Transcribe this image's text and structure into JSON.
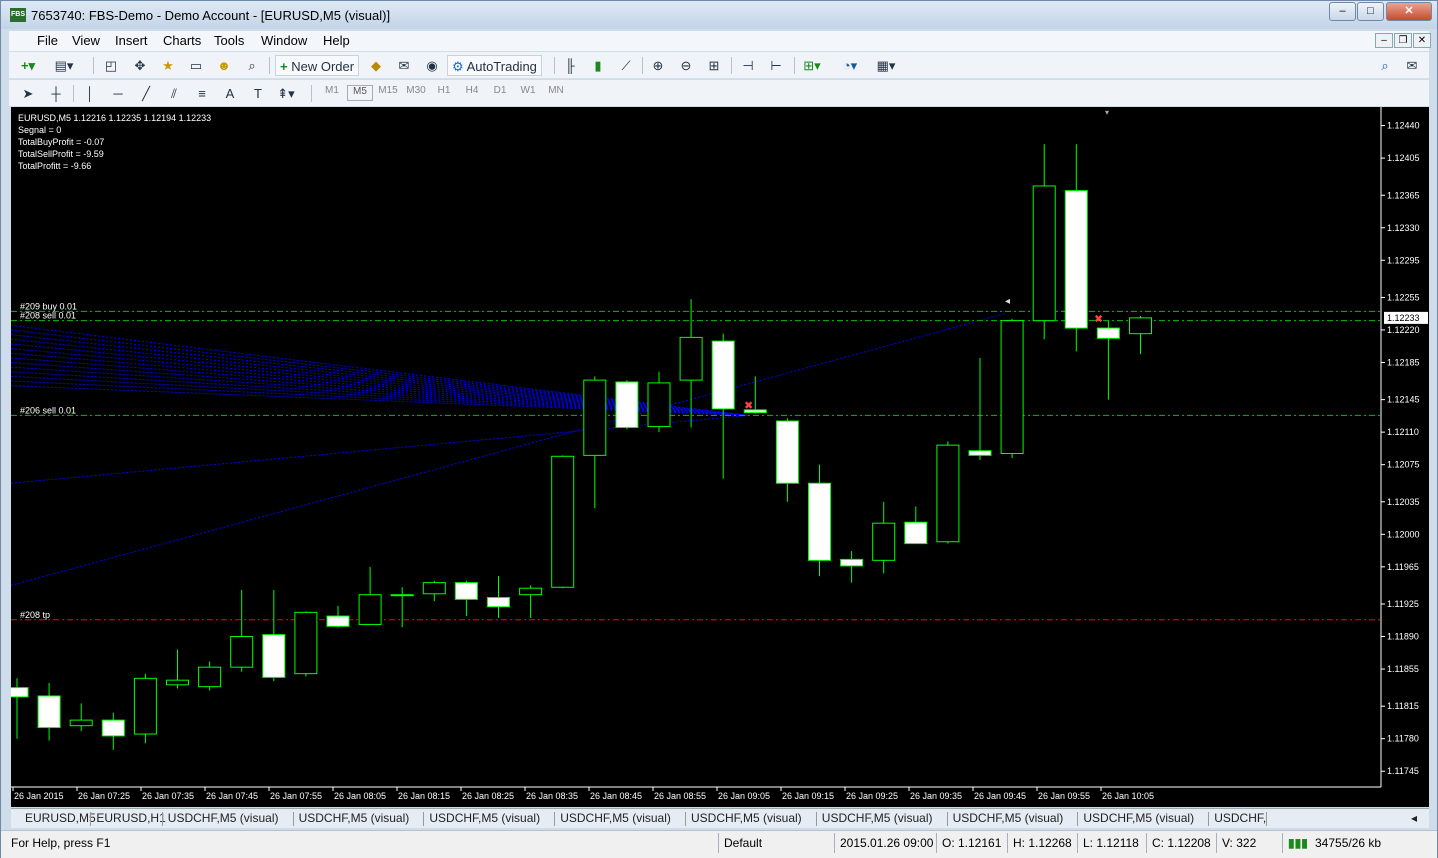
{
  "window": {
    "title": "7653740: FBS-Demo - Demo Account - [EURUSD,M5 (visual)]",
    "app_icon_text": "FBS"
  },
  "menu": [
    "File",
    "View",
    "Insert",
    "Charts",
    "Tools",
    "Window",
    "Help"
  ],
  "toolbar": {
    "new_order": "New Order",
    "auto_trading": "AutoTrading"
  },
  "timeframes": [
    "M1",
    "M5",
    "M15",
    "M30",
    "H1",
    "H4",
    "D1",
    "W1",
    "MN"
  ],
  "active_timeframe": "M5",
  "info": {
    "header": "EURUSD,M5  1.12216 1.12235 1.12194 1.12233",
    "lines": [
      "Segnal = 0",
      "TotalBuyProfit = -0.07",
      "TotalSellProfit = -9.59",
      "TotalProfitt = -9.66"
    ]
  },
  "order_labels": [
    "#209 buy 0.01",
    "#208 sell 0.01",
    "#206 sell 0.01",
    "#208 tp"
  ],
  "colors": {
    "chart_bg": "#000000",
    "candle_up_fill": "#000000",
    "candle_down_fill": "#ffffff",
    "candle_outline": "#00ff00",
    "order_line": "#00c000",
    "tp_line": "#ff0000",
    "trend_lines": "#0000ff",
    "current_price_bg": "#ffffff"
  },
  "chart_data": {
    "type": "candlestick",
    "symbol": "EURUSD",
    "timeframe": "M5",
    "ylim": [
      1.11728,
      1.1246
    ],
    "y_ticks": [
      "1.12440",
      "1.12405",
      "1.12365",
      "1.12330",
      "1.12295",
      "1.12255",
      "1.12220",
      "1.12185",
      "1.12145",
      "1.12110",
      "1.12075",
      "1.12035",
      "1.12000",
      "1.11965",
      "1.11925",
      "1.11890",
      "1.11855",
      "1.11815",
      "1.11780",
      "1.11745"
    ],
    "current_price": "1.12233",
    "x_labels": [
      "26 Jan 2015",
      "26 Jan 07:25",
      "26 Jan 07:35",
      "26 Jan 07:45",
      "26 Jan 07:55",
      "26 Jan 08:05",
      "26 Jan 08:15",
      "26 Jan 08:25",
      "26 Jan 08:35",
      "26 Jan 08:45",
      "26 Jan 08:55",
      "26 Jan 09:05",
      "26 Jan 09:15",
      "26 Jan 09:25",
      "26 Jan 09:35",
      "26 Jan 09:45",
      "26 Jan 09:55",
      "26 Jan 10:05"
    ],
    "candles": [
      {
        "o": 1.11835,
        "h": 1.11845,
        "l": 1.1178,
        "c": 1.11825
      },
      {
        "o": 1.11826,
        "h": 1.1184,
        "l": 1.11778,
        "c": 1.11792
      },
      {
        "o": 1.11794,
        "h": 1.11818,
        "l": 1.11788,
        "c": 1.118
      },
      {
        "o": 1.118,
        "h": 1.11808,
        "l": 1.11768,
        "c": 1.11783
      },
      {
        "o": 1.11785,
        "h": 1.1185,
        "l": 1.11775,
        "c": 1.11845
      },
      {
        "o": 1.11838,
        "h": 1.11876,
        "l": 1.11834,
        "c": 1.11843
      },
      {
        "o": 1.11836,
        "h": 1.11863,
        "l": 1.11832,
        "c": 1.11857
      },
      {
        "o": 1.11857,
        "h": 1.1194,
        "l": 1.11852,
        "c": 1.1189
      },
      {
        "o": 1.11892,
        "h": 1.1194,
        "l": 1.11842,
        "c": 1.11846
      },
      {
        "o": 1.1185,
        "h": 1.11917,
        "l": 1.11847,
        "c": 1.11916
      },
      {
        "o": 1.11912,
        "h": 1.11923,
        "l": 1.119,
        "c": 1.11901
      },
      {
        "o": 1.11903,
        "h": 1.11965,
        "l": 1.11903,
        "c": 1.11935
      },
      {
        "o": 1.11935,
        "h": 1.11943,
        "l": 1.119,
        "c": 1.11935
      },
      {
        "o": 1.11936,
        "h": 1.1195,
        "l": 1.11928,
        "c": 1.11948
      },
      {
        "o": 1.11948,
        "h": 1.1195,
        "l": 1.11912,
        "c": 1.1193
      },
      {
        "o": 1.11932,
        "h": 1.11955,
        "l": 1.1191,
        "c": 1.11922
      },
      {
        "o": 1.11935,
        "h": 1.11945,
        "l": 1.1191,
        "c": 1.11942
      },
      {
        "o": 1.11943,
        "h": 1.12085,
        "l": 1.11942,
        "c": 1.12084
      },
      {
        "o": 1.12085,
        "h": 1.1217,
        "l": 1.12028,
        "c": 1.12166
      },
      {
        "o": 1.12164,
        "h": 1.12166,
        "l": 1.12113,
        "c": 1.12115
      },
      {
        "o": 1.12116,
        "h": 1.12175,
        "l": 1.1211,
        "c": 1.12163
      },
      {
        "o": 1.12166,
        "h": 1.12253,
        "l": 1.12115,
        "c": 1.12212
      },
      {
        "o": 1.12208,
        "h": 1.12216,
        "l": 1.1206,
        "c": 1.12135
      },
      {
        "o": 1.12134,
        "h": 1.1217,
        "l": 1.1213,
        "c": 1.12131
      },
      {
        "o": 1.12122,
        "h": 1.12125,
        "l": 1.12035,
        "c": 1.12055
      },
      {
        "o": 1.12055,
        "h": 1.12075,
        "l": 1.11955,
        "c": 1.11972
      },
      {
        "o": 1.11973,
        "h": 1.11982,
        "l": 1.11948,
        "c": 1.11966
      },
      {
        "o": 1.11972,
        "h": 1.12035,
        "l": 1.11958,
        "c": 1.12012
      },
      {
        "o": 1.12013,
        "h": 1.1203,
        "l": 1.1199,
        "c": 1.1199
      },
      {
        "o": 1.11992,
        "h": 1.121,
        "l": 1.1199,
        "c": 1.12096
      },
      {
        "o": 1.1209,
        "h": 1.1219,
        "l": 1.1208,
        "c": 1.12085
      },
      {
        "o": 1.12087,
        "h": 1.12232,
        "l": 1.12082,
        "c": 1.1223
      },
      {
        "o": 1.1223,
        "h": 1.1242,
        "l": 1.1221,
        "c": 1.12375
      },
      {
        "o": 1.1237,
        "h": 1.1242,
        "l": 1.12197,
        "c": 1.12222
      },
      {
        "o": 1.12222,
        "h": 1.1223,
        "l": 1.12145,
        "c": 1.12211
      },
      {
        "o": 1.12216,
        "h": 1.12235,
        "l": 1.12194,
        "c": 1.12233
      }
    ],
    "order_lines": [
      {
        "label": "#209 buy 0.01",
        "price": 1.1224,
        "style": "green-dashdot"
      },
      {
        "label": "#208 sell 0.01",
        "price": 1.1223,
        "style": "green-dashdot"
      },
      {
        "label": "#206 sell 0.01",
        "price": 1.12128,
        "style": "green-dashdot"
      },
      {
        "label": "#208 tp",
        "price": 1.11908,
        "style": "red-dashdot"
      }
    ]
  },
  "tabs": [
    "EURUSD,M5",
    "EURUSD,H1",
    "USDCHF,M5 (visual)",
    "USDCHF,M5 (visual)",
    "USDCHF,M5 (visual)",
    "USDCHF,M5 (visual)",
    "USDCHF,M5 (visual)",
    "USDCHF,M5 (visual)",
    "USDCHF,M5 (visual)",
    "USDCHF,M5 (visual)",
    "USDCHF,"
  ],
  "status": {
    "help": "For Help, press F1",
    "profile": "Default",
    "datetime": "2015.01.26 09:00",
    "open": "O: 1.12161",
    "high": "H: 1.12268",
    "low": "L: 1.12118",
    "close": "C: 1.12208",
    "volume": "V: 322",
    "traffic": "34755/26 kb"
  }
}
